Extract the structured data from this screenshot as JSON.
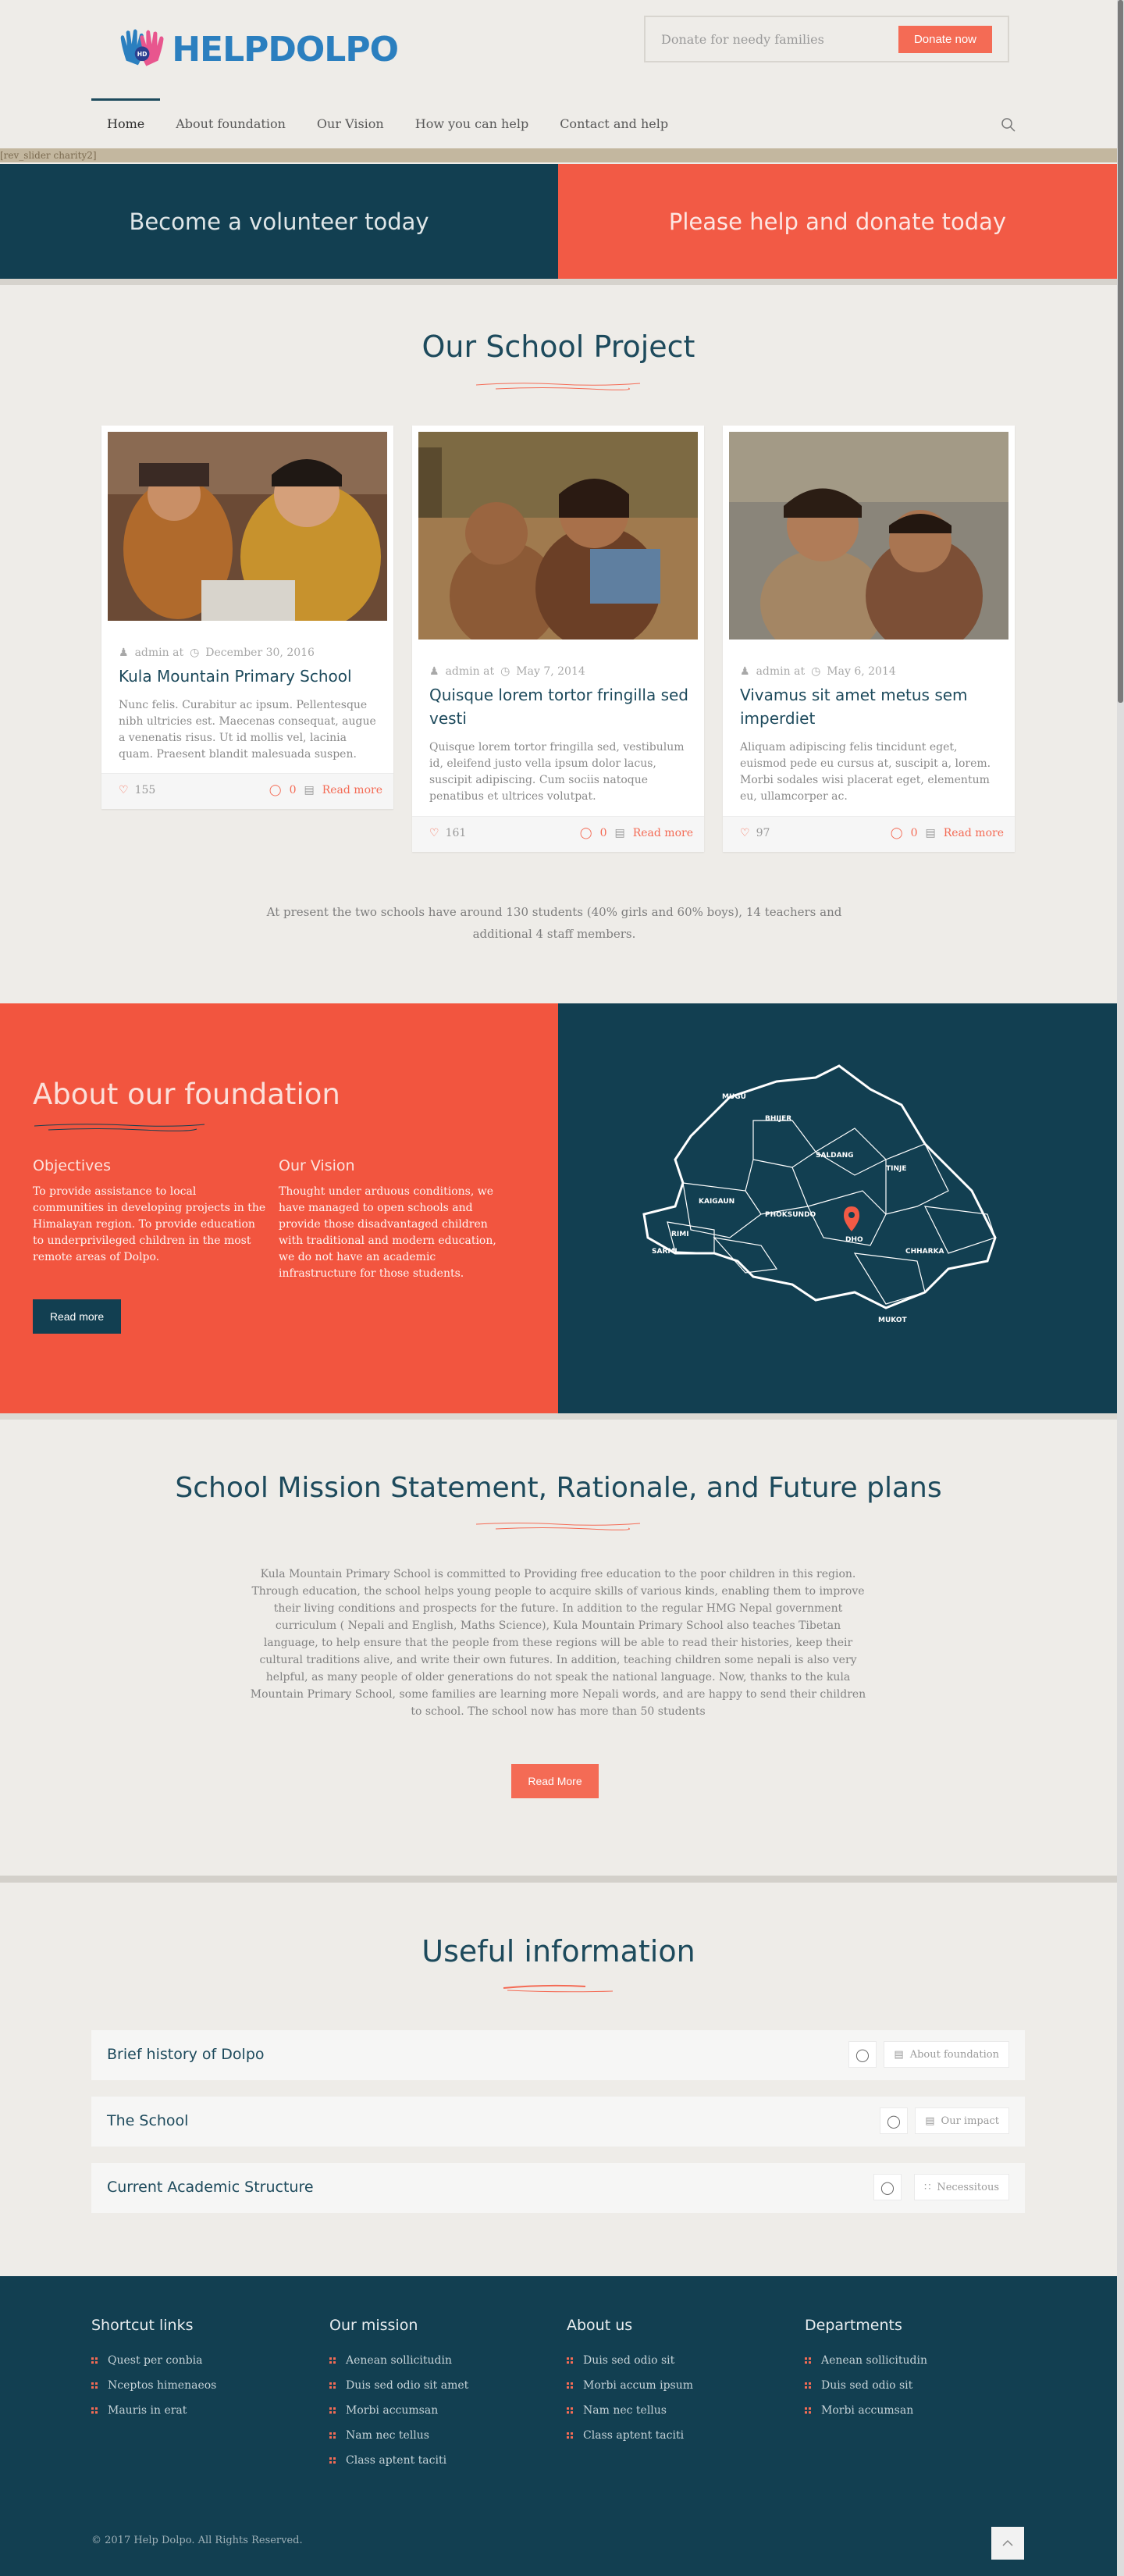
{
  "header": {
    "logo_initials": "HD",
    "logo_text": "HELPDOLPO",
    "donate_label": "Donate for needy families",
    "donate_button": "Donate now",
    "nav": [
      "Home",
      "About foundation",
      "Our Vision",
      "How you can help",
      "Contact and help"
    ],
    "slider_placeholder": "[rev_slider charity2]"
  },
  "cta": {
    "volunteer": "Become a volunteer today",
    "donate": "Please help and donate today"
  },
  "school_project": {
    "title": "Our School Project",
    "cards": [
      {
        "author": "admin at",
        "date": "December 30, 2016",
        "title": "Kula Mountain Primary School",
        "excerpt": "Nunc felis. Curabitur ac ipsum. Pellentesque nibh ultricies est. Maecenas consequat, augue a venenatis risus. Ut id mollis vel, lacinia quam. Praesent blandit malesuada suspen.",
        "likes": "155",
        "comments": "0",
        "read_more": "Read more"
      },
      {
        "author": "admin at",
        "date": "May 7, 2014",
        "title": "Quisque lorem tortor fringilla sed vesti",
        "excerpt": "Quisque lorem tortor fringilla sed, vestibulum id, eleifend justo vella ipsum dolor lacus, suscipit adipiscing. Cum sociis natoque penatibus et ultrices volutpat.",
        "likes": "161",
        "comments": "0",
        "read_more": "Read more"
      },
      {
        "author": "admin at",
        "date": "May 6, 2014",
        "title": "Vivamus sit amet metus sem imperdiet",
        "excerpt": "Aliquam adipiscing felis tincidunt eget, euismod pede eu cursus at, suscipit a, lorem. Morbi sodales wisi placerat eget, elementum eu, ullamcorper ac.",
        "likes": "97",
        "comments": "0",
        "read_more": "Read more"
      }
    ],
    "stats": "At present the two schools have around 130 students (40% girls and 60% boys), 14 teachers and additional 4 staff members."
  },
  "foundation": {
    "title": "About our foundation",
    "objectives_title": "Objectives",
    "objectives_text": "To provide assistance to local communities in developing projects in the Himalayan region. To provide education to underprivileged children in the most remote areas of Dolpo.",
    "vision_title": "Our Vision",
    "vision_text": "Thought under arduous conditions, we have managed to open schools and provide those disadvantaged children with traditional and modern education, we do not have an academic infrastructure for those students.",
    "read_more": "Read more",
    "map_labels": [
      "MUGU",
      "BHIJER",
      "SALDANG",
      "TINJE",
      "KAIGAUN",
      "PHOKSUNDO",
      "DHO",
      "CHHARKA",
      "RIMI",
      "SARMI",
      "MUKOT"
    ]
  },
  "mission": {
    "title": "School Mission Statement, Rationale, and Future plans",
    "text": "Kula Mountain Primary School is committed to Providing free education to the poor children in this region. Through education, the school helps young people to acquire skills of various kinds, enabling them to improve their living conditions and prospects for the future. In addition to the regular HMG Nepal government curriculum ( Nepali and English, Maths Science), Kula Mountain Primary School also teaches Tibetan language, to help ensure that the people from these regions will be able to read their histories, keep their cultural traditions alive, and write their own futures. In addition, teaching children some nepali is also very helpful, as many people of older generations do not speak the national language. Now, thanks to the kula Mountain Primary School, some families are learning more Nepali words, and are happy to send their children to school. The school now has more than 50 students",
    "read_more": "Read More"
  },
  "useful": {
    "title": "Useful information",
    "rows": [
      {
        "label": "Brief history of Dolpo",
        "tag": "About foundation"
      },
      {
        "label": "The School",
        "tag": "Our impact"
      },
      {
        "label": "Current Academic Structure",
        "tag": "Necessitous"
      }
    ]
  },
  "footer": {
    "columns": [
      {
        "title": "Shortcut links",
        "items": [
          "Quest per conbia",
          "Nceptos himenaeos",
          "Mauris in erat"
        ]
      },
      {
        "title": "Our mission",
        "items": [
          "Aenean sollicitudin",
          "Duis sed odio sit amet",
          "Morbi accumsan",
          "Nam nec tellus",
          "Class aptent taciti"
        ]
      },
      {
        "title": "About us",
        "items": [
          "Duis sed odio sit",
          "Morbi accum ipsum",
          "Nam nec tellus",
          "Class aptent taciti"
        ]
      },
      {
        "title": "Departments",
        "items": [
          "Aenean sollicitudin",
          "Duis sed odio sit",
          "Morbi accumsan"
        ]
      }
    ],
    "copyright": "© 2017 Help Dolpo. All Rights Reserved."
  },
  "colors": {
    "teal": "#123f51",
    "coral": "#f25a45",
    "background": "#eeece8"
  }
}
